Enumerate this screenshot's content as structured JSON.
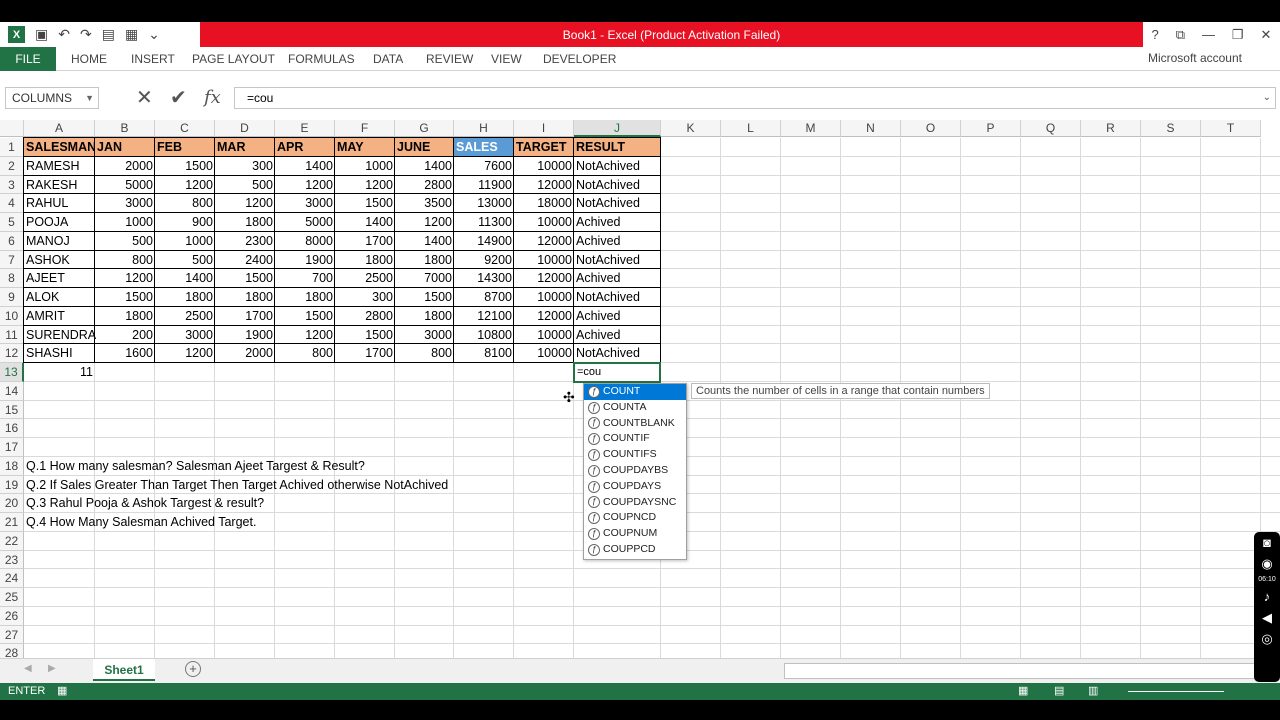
{
  "titlebar": {
    "title": "Book1 -  Excel (Product Activation Failed)",
    "help": "?",
    "restore": "⧉",
    "minimize": "—",
    "maximize": "❐",
    "close": "✕"
  },
  "ribbon": {
    "tabs": [
      "FILE",
      "HOME",
      "INSERT",
      "PAGE LAYOUT",
      "FORMULAS",
      "DATA",
      "REVIEW",
      "VIEW",
      "DEVELOPER"
    ],
    "account": "Microsoft account"
  },
  "formula_bar": {
    "name_box": "COLUMNS",
    "cancel": "✕",
    "enter": "✔",
    "fx": "fx",
    "formula": "=cou"
  },
  "columns": [
    "A",
    "B",
    "C",
    "D",
    "E",
    "F",
    "G",
    "H",
    "I",
    "J",
    "K",
    "L",
    "M",
    "N",
    "O",
    "P",
    "Q",
    "R",
    "S",
    "T"
  ],
  "rows": [
    "1",
    "2",
    "3",
    "4",
    "5",
    "6",
    "7",
    "8",
    "9",
    "10",
    "11",
    "12",
    "13",
    "14",
    "15",
    "16",
    "17",
    "18",
    "19",
    "20",
    "21",
    "22",
    "23",
    "24",
    "25",
    "26",
    "27",
    "28"
  ],
  "table": {
    "headers": [
      "SALESMAN",
      "JAN",
      "FEB",
      "MAR",
      "APR",
      "MAY",
      "JUNE",
      "SALES",
      "TARGET",
      "RESULT"
    ],
    "rows": [
      [
        "RAMESH",
        "2000",
        "1500",
        "300",
        "1400",
        "1000",
        "1400",
        "7600",
        "10000",
        "NotAchived"
      ],
      [
        "RAKESH",
        "5000",
        "1200",
        "500",
        "1200",
        "1200",
        "2800",
        "11900",
        "12000",
        "NotAchived"
      ],
      [
        "RAHUL",
        "3000",
        "800",
        "1200",
        "3000",
        "1500",
        "3500",
        "13000",
        "18000",
        "NotAchived"
      ],
      [
        "POOJA",
        "1000",
        "900",
        "1800",
        "5000",
        "1400",
        "1200",
        "11300",
        "10000",
        "Achived"
      ],
      [
        "MANOJ",
        "500",
        "1000",
        "2300",
        "8000",
        "1700",
        "1400",
        "14900",
        "12000",
        "Achived"
      ],
      [
        "ASHOK",
        "800",
        "500",
        "2400",
        "1900",
        "1800",
        "1800",
        "9200",
        "10000",
        "NotAchived"
      ],
      [
        "AJEET",
        "1200",
        "1400",
        "1500",
        "700",
        "2500",
        "7000",
        "14300",
        "12000",
        "Achived"
      ],
      [
        "ALOK",
        "1500",
        "1800",
        "1800",
        "1800",
        "300",
        "1500",
        "8700",
        "10000",
        "NotAchived"
      ],
      [
        "AMRIT",
        "1800",
        "2500",
        "1700",
        "1500",
        "2800",
        "1800",
        "12100",
        "12000",
        "Achived"
      ],
      [
        "SURENDRA",
        "200",
        "3000",
        "1900",
        "1200",
        "1500",
        "3000",
        "10800",
        "10000",
        "Achived"
      ],
      [
        "SHASHI",
        "1600",
        "1200",
        "2000",
        "800",
        "1700",
        "800",
        "8100",
        "10000",
        "NotAchived"
      ]
    ],
    "count_result": "11",
    "editing_cell": "=cou"
  },
  "questions": [
    "Q.1 How many salesman? Salesman Ajeet Targest & Result?",
    "Q.2 If Sales Greater Than Target Then Target Achived otherwise NotAchived",
    "Q.3 Rahul Pooja & Ashok Targest & result?",
    "Q.4 How Many Salesman Achived Target."
  ],
  "autocomplete": {
    "items": [
      "COUNT",
      "COUNTA",
      "COUNTBLANK",
      "COUNTIF",
      "COUNTIFS",
      "COUPDAYBS",
      "COUPDAYS",
      "COUPDAYSNC",
      "COUPNCD",
      "COUPNUM",
      "COUPPCD"
    ],
    "selected": "COUNT",
    "tooltip": "Counts the number of cells in a range that contain numbers"
  },
  "sheets": {
    "active": "Sheet1",
    "add": "+"
  },
  "status": {
    "mode": "ENTER"
  },
  "colors": {
    "excel_green": "#217346",
    "header_orange": "#f4b183",
    "sales_blue": "#5b9bd5",
    "title_red": "#e81123"
  }
}
